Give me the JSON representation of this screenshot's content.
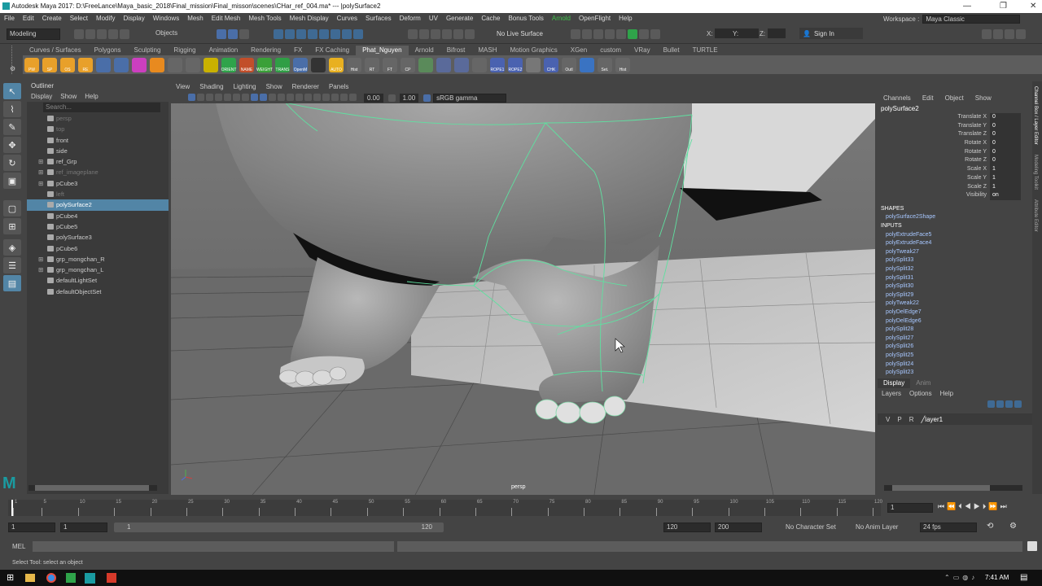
{
  "window_title": "Autodesk Maya 2017: D:\\FreeLance\\Maya_basic_2018\\Final_mission\\Final_misson\\scenes\\CHar_ref_004.ma*  ---  |polySurface2",
  "menus": [
    "File",
    "Edit",
    "Create",
    "Select",
    "Modify",
    "Display",
    "Windows",
    "Mesh",
    "Edit Mesh",
    "Mesh Tools",
    "Mesh Display",
    "Curves",
    "Surfaces",
    "Deform",
    "UV",
    "Generate",
    "Cache",
    "Bonus Tools",
    "Arnold",
    "OpenFlight",
    "Help"
  ],
  "workspace": {
    "label": "Workspace :",
    "value": "Maya Classic"
  },
  "status": {
    "mode": "Modeling",
    "objects": "Objects",
    "live_surface": "No Live Surface",
    "x": "X:",
    "y": "Y:",
    "z": "Z:",
    "sign_in": "Sign In"
  },
  "shelf_tabs": [
    "Curves / Surfaces",
    "Polygons",
    "Sculpting",
    "Rigging",
    "Animation",
    "Rendering",
    "FX",
    "FX Caching",
    "Phat_Nguyen",
    "Arnold",
    "Bifrost",
    "MASH",
    "Motion Graphics",
    "XGen",
    "custom",
    "VRay",
    "Bullet",
    "TURTLE"
  ],
  "shelf_active": "Phat_Nguyen",
  "shelf_icons": [
    {
      "label": "PW",
      "color": "#e8a02a"
    },
    {
      "label": "SP",
      "color": "#e8a02a"
    },
    {
      "label": "OS",
      "color": "#e8a02a"
    },
    {
      "label": "RE",
      "color": "#e8a02a"
    },
    {
      "label": "",
      "color": "#4a6ea8"
    },
    {
      "label": "",
      "color": "#4a6ea8"
    },
    {
      "label": "",
      "color": "#cc3fbf"
    },
    {
      "label": "",
      "color": "#e88a1f"
    },
    {
      "label": "",
      "color": "#666"
    },
    {
      "label": "",
      "color": "#666"
    },
    {
      "label": "",
      "color": "#c9b100"
    },
    {
      "label": "ORIENT",
      "color": "#2fa34a"
    },
    {
      "label": "NAME",
      "color": "#c24e2a"
    },
    {
      "label": "WEIGHT",
      "color": "#3aa038"
    },
    {
      "label": "TRANS",
      "color": "#2f9e45"
    },
    {
      "label": "OpenM",
      "color": "#4a6ea8"
    },
    {
      "label": "",
      "color": "#333"
    },
    {
      "label": "AUTO",
      "color": "#e8b020"
    },
    {
      "label": "Hist",
      "color": "#666"
    },
    {
      "label": "RT",
      "color": "#666"
    },
    {
      "label": "FT",
      "color": "#666"
    },
    {
      "label": "CP",
      "color": "#666"
    },
    {
      "label": "",
      "color": "#5a8a5a"
    },
    {
      "label": "",
      "color": "#5a6a9a"
    },
    {
      "label": "",
      "color": "#5a6a9a"
    },
    {
      "label": "",
      "color": "#666"
    },
    {
      "label": "ROPE1",
      "color": "#4a62b0"
    },
    {
      "label": "ROPE2",
      "color": "#4a62b0"
    },
    {
      "label": "",
      "color": "#777"
    },
    {
      "label": "CHK",
      "color": "#4a62b0"
    },
    {
      "label": "Outl",
      "color": "#666"
    },
    {
      "label": "",
      "color": "#3a73c2"
    },
    {
      "label": "Set.",
      "color": "#666"
    },
    {
      "label": "Hist",
      "color": "#666"
    }
  ],
  "outliner": {
    "title": "Outliner",
    "menus": [
      "Display",
      "Show",
      "Help"
    ],
    "search_placeholder": "Search...",
    "items": [
      {
        "name": "persp",
        "dim": true,
        "exp": false
      },
      {
        "name": "top",
        "dim": true,
        "exp": false
      },
      {
        "name": "front",
        "dim": false,
        "exp": false
      },
      {
        "name": "side",
        "dim": false,
        "exp": false
      },
      {
        "name": "ref_Grp",
        "dim": false,
        "exp": true
      },
      {
        "name": "ref_imageplane",
        "dim": true,
        "exp": true
      },
      {
        "name": "pCube3",
        "dim": false,
        "exp": true
      },
      {
        "name": "left",
        "dim": true,
        "exp": false
      },
      {
        "name": "polySurface2",
        "dim": false,
        "exp": false,
        "selected": true
      },
      {
        "name": "pCube4",
        "dim": false,
        "exp": false
      },
      {
        "name": "pCube5",
        "dim": false,
        "exp": false
      },
      {
        "name": "polySurface3",
        "dim": false,
        "exp": false
      },
      {
        "name": "pCube6",
        "dim": false,
        "exp": false
      },
      {
        "name": "grp_mongchan_R",
        "dim": false,
        "exp": true
      },
      {
        "name": "grp_mongchan_L",
        "dim": false,
        "exp": true
      },
      {
        "name": "defaultLightSet",
        "dim": false,
        "exp": false
      },
      {
        "name": "defaultObjectSet",
        "dim": false,
        "exp": false
      }
    ]
  },
  "viewport": {
    "menus": [
      "View",
      "Shading",
      "Lighting",
      "Show",
      "Renderer",
      "Panels"
    ],
    "camera_label": "persp",
    "near_value": "0.00",
    "far_value": "1.00",
    "color_space": "sRGB gamma"
  },
  "channel_box": {
    "menus": [
      "Channels",
      "Edit",
      "Object",
      "Show"
    ],
    "object_name": "polySurface2",
    "channels": [
      {
        "label": "Translate X",
        "value": "0"
      },
      {
        "label": "Translate Y",
        "value": "0"
      },
      {
        "label": "Translate Z",
        "value": "0"
      },
      {
        "label": "Rotate X",
        "value": "0"
      },
      {
        "label": "Rotate Y",
        "value": "0"
      },
      {
        "label": "Rotate Z",
        "value": "0"
      },
      {
        "label": "Scale X",
        "value": "1"
      },
      {
        "label": "Scale Y",
        "value": "1"
      },
      {
        "label": "Scale Z",
        "value": "1"
      },
      {
        "label": "Visibility",
        "value": "on"
      }
    ],
    "shapes_header": "SHAPES",
    "shape": "polySurface2Shape",
    "inputs_header": "INPUTS",
    "inputs": [
      "polyExtrudeFace5",
      "polyExtrudeFace4",
      "polyTweak27",
      "polySplit33",
      "polySplit32",
      "polySplit31",
      "polySplit30",
      "polySplit29",
      "polyTweak22",
      "polyDelEdge7",
      "polyDelEdge6",
      "polySplit28",
      "polySplit27",
      "polySplit26",
      "polySplit25",
      "polySplit24",
      "polySplit23"
    ]
  },
  "layer_editor": {
    "tabs": [
      "Display",
      "Anim"
    ],
    "menus": [
      "Layers",
      "Options",
      "Help"
    ],
    "layer": {
      "v": "V",
      "p": "P",
      "r": "R",
      "name": "layer1"
    }
  },
  "side_tabs": [
    "Channel Box / Layer Editor",
    "Modeling Toolkit",
    "Attribute Editor"
  ],
  "timeline": {
    "ticks": [
      "1",
      "5",
      "10",
      "15",
      "20",
      "25",
      "30",
      "35",
      "40",
      "45",
      "50",
      "55",
      "60",
      "65",
      "70",
      "75",
      "80",
      "85",
      "90",
      "95",
      "100",
      "105",
      "110",
      "115",
      "120"
    ],
    "current": "1"
  },
  "range": {
    "start": "1",
    "inner_start": "1",
    "slider_start": "1",
    "slider_end": "120",
    "end": "120",
    "anim_end": "200",
    "character_set": "No Character Set",
    "anim_layer": "No Anim Layer",
    "fps": "24 fps"
  },
  "command_line": {
    "label": "MEL"
  },
  "help_line": "Select Tool: select an object",
  "taskbar": {
    "time": "7:41 AM"
  }
}
